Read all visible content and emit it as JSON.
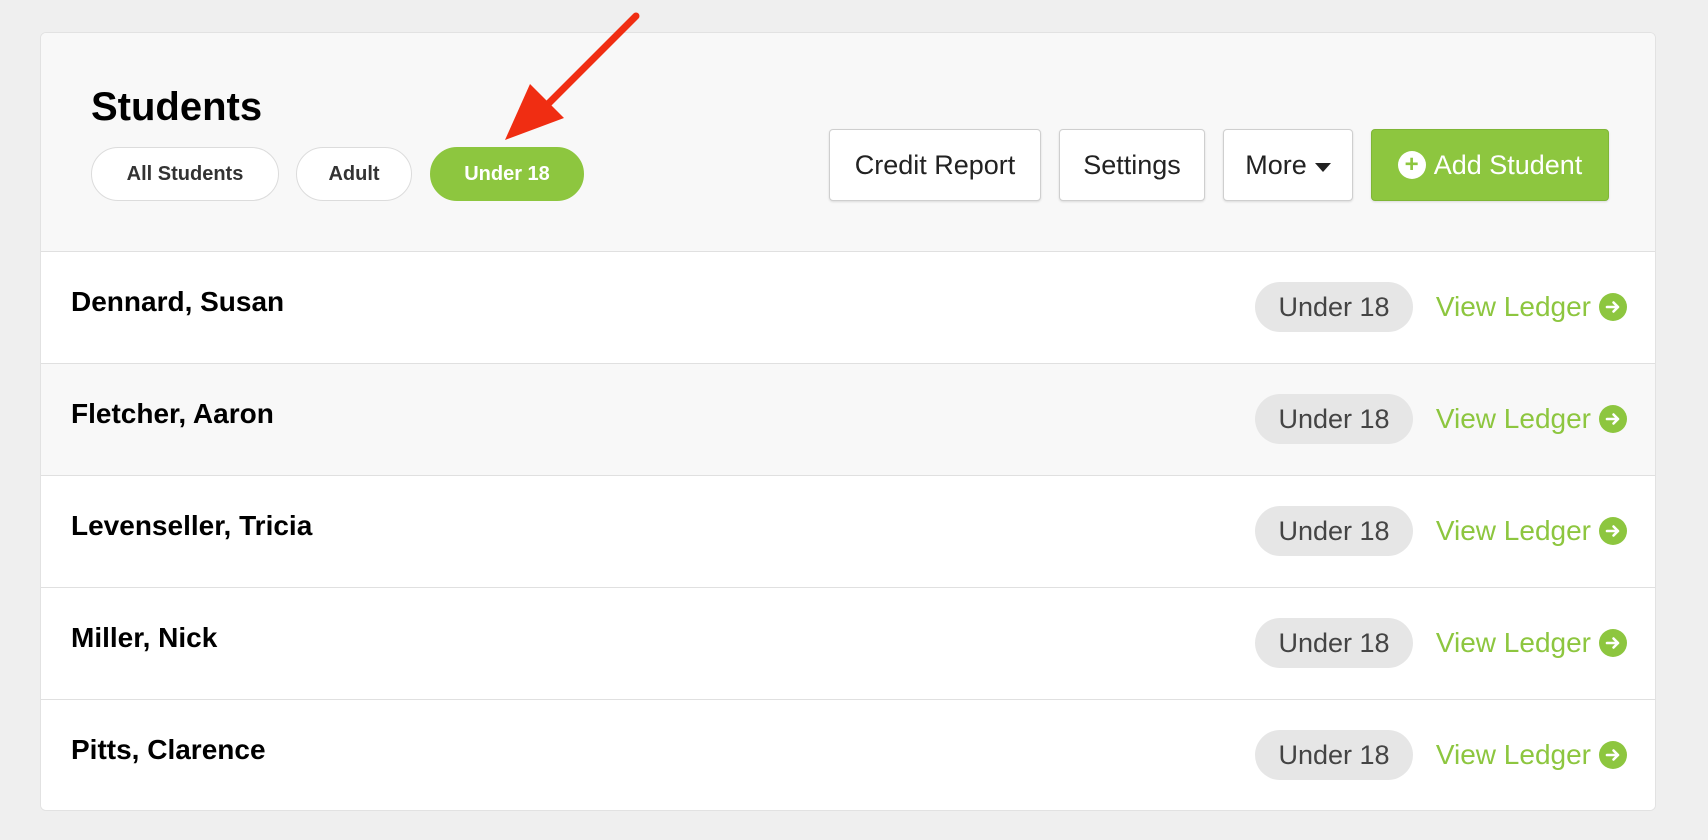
{
  "header": {
    "title": "Students",
    "filters": [
      {
        "label": "All Students",
        "active": false
      },
      {
        "label": "Adult",
        "active": false
      },
      {
        "label": "Under 18",
        "active": true
      }
    ],
    "buttons": {
      "credit_report": "Credit Report",
      "settings": "Settings",
      "more": "More",
      "add_student": "Add Student"
    }
  },
  "students": [
    {
      "name": "Dennard, Susan",
      "age_group": "Under 18",
      "link": "View Ledger"
    },
    {
      "name": "Fletcher, Aaron",
      "age_group": "Under 18",
      "link": "View Ledger"
    },
    {
      "name": "Levenseller, Tricia",
      "age_group": "Under 18",
      "link": "View Ledger"
    },
    {
      "name": "Miller, Nick",
      "age_group": "Under 18",
      "link": "View Ledger"
    },
    {
      "name": "Pitts, Clarence",
      "age_group": "Under 18",
      "link": "View Ledger"
    }
  ],
  "icons": {
    "add": "plus-circle-icon",
    "more": "caret-down-icon",
    "ledger": "arrow-right-circle-icon",
    "annotation": "red-arrow-annotation"
  },
  "colors": {
    "accent": "#8dc63f",
    "badge_bg": "#e6e6e6",
    "annotation": "#f02d12"
  }
}
